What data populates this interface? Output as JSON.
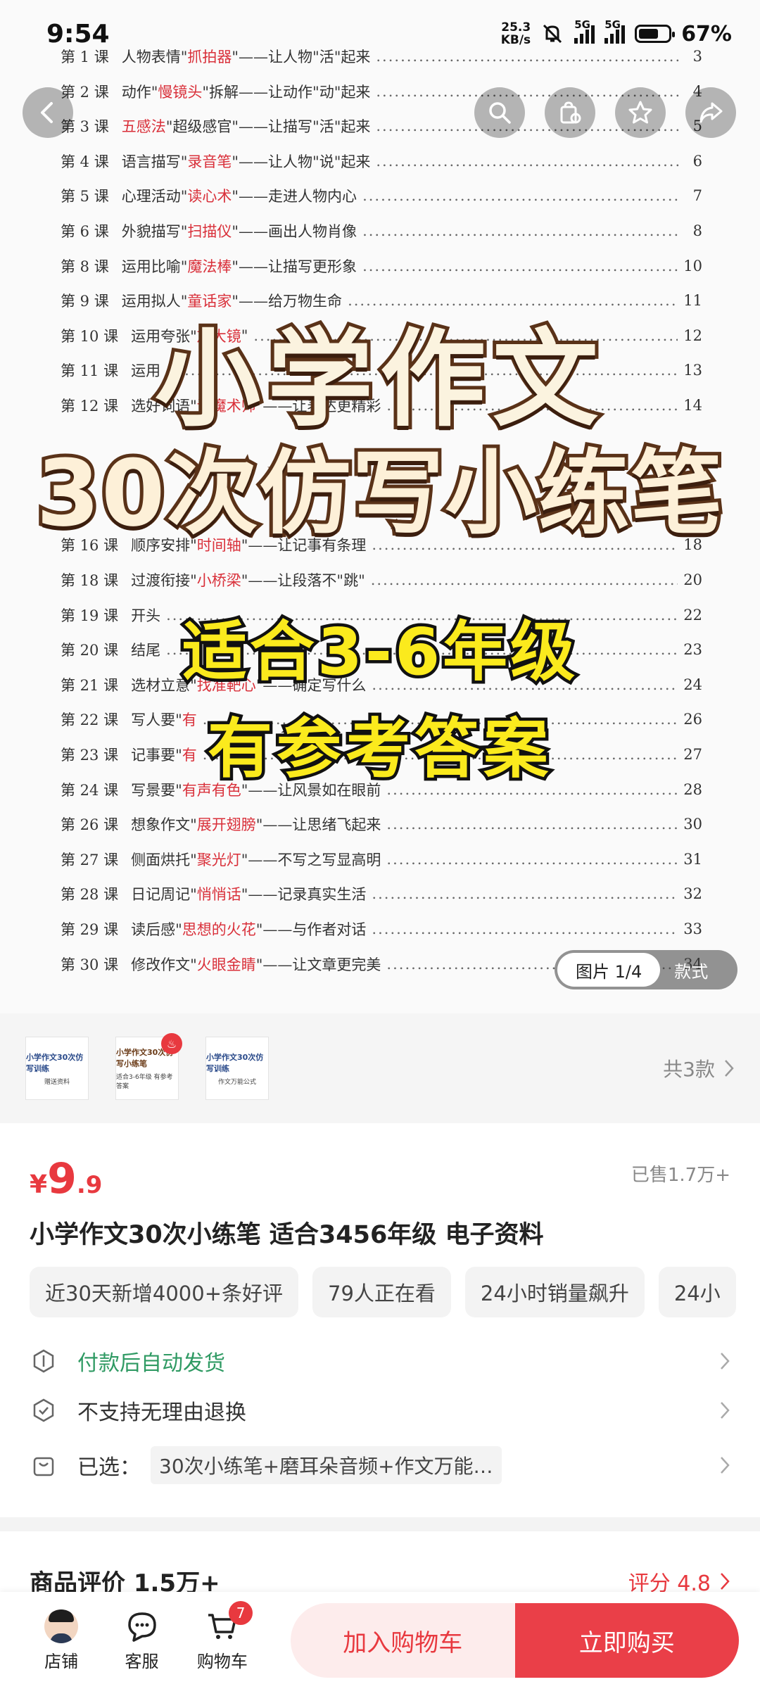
{
  "status_bar": {
    "time": "9:54",
    "net_speed_value": "25.3",
    "net_speed_unit": "KB/s",
    "signal_1_label": "5G",
    "signal_2_label": "5G",
    "battery_percent": "67%",
    "battery_level": 0.67
  },
  "toc": [
    {
      "num": "第 1 课",
      "pre": "人物表情\"",
      "hl": "抓拍器",
      "post": "\"——让人物\"活\"起来",
      "page": "3"
    },
    {
      "num": "第 2 课",
      "pre": "动作\"",
      "hl": "慢镜头",
      "post": "\"拆解——让动作\"动\"起来",
      "page": "4"
    },
    {
      "num": "第 3 课",
      "pre": "",
      "hl": "五感法",
      "post": "\"超级感官\"——让描写\"活\"起来",
      "page": "5"
    },
    {
      "num": "第 4 课",
      "pre": "语言描写\"",
      "hl": "录音笔",
      "post": "\"——让人物\"说\"起来",
      "page": "6"
    },
    {
      "num": "第 5 课",
      "pre": "心理活动\"",
      "hl": "读心术",
      "post": "\"——走进人物内心",
      "page": "7"
    },
    {
      "num": "第 6 课",
      "pre": "外貌描写\"",
      "hl": "扫描仪",
      "post": "\"——画出人物肖像",
      "page": "8"
    },
    {
      "num": "第 8 课",
      "pre": "运用比喻\"",
      "hl": "魔法棒",
      "post": "\"——让描写更形象",
      "page": "10"
    },
    {
      "num": "第 9 课",
      "pre": "运用拟人\"",
      "hl": "童话家",
      "post": "\"——给万物生命",
      "page": "11"
    },
    {
      "num": "第 10 课",
      "pre": "运用夸张\"",
      "hl": "放大镜",
      "post": "\"",
      "page": "12"
    },
    {
      "num": "第 11 课",
      "pre": "运用",
      "hl": "",
      "post": "",
      "page": "13"
    },
    {
      "num": "第 12 课",
      "pre": "选好词语\"",
      "hl": "语魔术师",
      "post": "\"——让表达更精彩",
      "page": "14"
    },
    {
      "num": "",
      "pre": "",
      "hl": "",
      "post": "",
      "page": ""
    },
    {
      "num": "",
      "pre": "",
      "hl": "",
      "post": "",
      "page": ""
    },
    {
      "num": "",
      "pre": "",
      "hl": "",
      "post": "",
      "page": ""
    },
    {
      "num": "第 16 课",
      "pre": "顺序安排\"",
      "hl": "时间轴",
      "post": "\"——让记事有条理",
      "page": "18"
    },
    {
      "num": "第 18 课",
      "pre": "过渡衔接\"",
      "hl": "小桥梁",
      "post": "\"——让段落不\"跳\"",
      "page": "20"
    },
    {
      "num": "第 19 课",
      "pre": "开头",
      "hl": "",
      "post": "",
      "page": "22"
    },
    {
      "num": "第 20 课",
      "pre": "结尾",
      "hl": "",
      "post": "",
      "page": "23"
    },
    {
      "num": "第 21 课",
      "pre": "选材立意\"",
      "hl": "找准靶心",
      "post": "\"——确定写什么",
      "page": "24"
    },
    {
      "num": "第 22 课",
      "pre": "写人要\"",
      "hl": "有",
      "post": "",
      "page": "26"
    },
    {
      "num": "第 23 课",
      "pre": "记事要\"",
      "hl": "有",
      "post": "",
      "page": "27"
    },
    {
      "num": "第 24 课",
      "pre": "写景要\"",
      "hl": "有声有色",
      "post": "\"——让风景如在眼前",
      "page": "28"
    },
    {
      "num": "第 26 课",
      "pre": "想象作文\"",
      "hl": "展开翅膀",
      "post": "\"——让思绪飞起来",
      "page": "30"
    },
    {
      "num": "第 27 课",
      "pre": "侧面烘托\"",
      "hl": "聚光灯",
      "post": "\"——不写之写显高明",
      "page": "31"
    },
    {
      "num": "第 28 课",
      "pre": "日记周记\"",
      "hl": "悄悄话",
      "post": "\"——记录真实生活",
      "page": "32"
    },
    {
      "num": "第 29 课",
      "pre": "读后感\"",
      "hl": "思想的火花",
      "post": "\"——与作者对话",
      "page": "33"
    },
    {
      "num": "第 30 课",
      "pre": "修改作文\"",
      "hl": "火眼金睛",
      "post": "\"——让文章更完美",
      "page": "34"
    }
  ],
  "overlay": {
    "line1": "小学作文",
    "line2": "30次仿写小练笔",
    "line3": "适合3-6年级",
    "line4": "有参考答案"
  },
  "nav_icons": [
    "back-icon",
    "search-icon",
    "shop-bag-icon",
    "star-icon",
    "share-icon"
  ],
  "image_pill": {
    "active": "图片 1/4",
    "other": "款式"
  },
  "styles": {
    "thumbs": [
      {
        "t1": "小学作文30次仿写训练",
        "t2": "赠送资料"
      },
      {
        "t1": "小学作文30次仿写小练笔",
        "t2": "适合3-6年级 有参考答案"
      },
      {
        "t1": "小学作文30次仿写训练",
        "t2": "作文万能公式"
      }
    ],
    "count_label": "共3款"
  },
  "price": {
    "currency": "¥",
    "integer": "9",
    "decimal": ".9"
  },
  "sold": "已售1.7万+",
  "product_title": "小学作文30次小练笔 适合3456年级 电子资料",
  "tags": [
    "近30天新增4000+条好评",
    "79人正在看",
    "24小时销量飙升",
    "24小"
  ],
  "info": {
    "delivery": "付款后自动发货",
    "no_return": "不支持无理由退换",
    "selected_label": "已选：",
    "selected_value": "30次小练笔+磨耳朵音频+作文万能…"
  },
  "reviews": {
    "title": "商品评价 1.5万+",
    "score": "评分 4.8"
  },
  "bottom_bar": {
    "shop_label": "店铺",
    "service_label": "客服",
    "cart_label": "购物车",
    "cart_badge": "7",
    "add_to_cart": "加入购物车",
    "buy_now": "立即购买"
  },
  "colors": {
    "accent": "#e8393f",
    "green": "#2f9a63",
    "title_fill": "#fbea1d"
  }
}
